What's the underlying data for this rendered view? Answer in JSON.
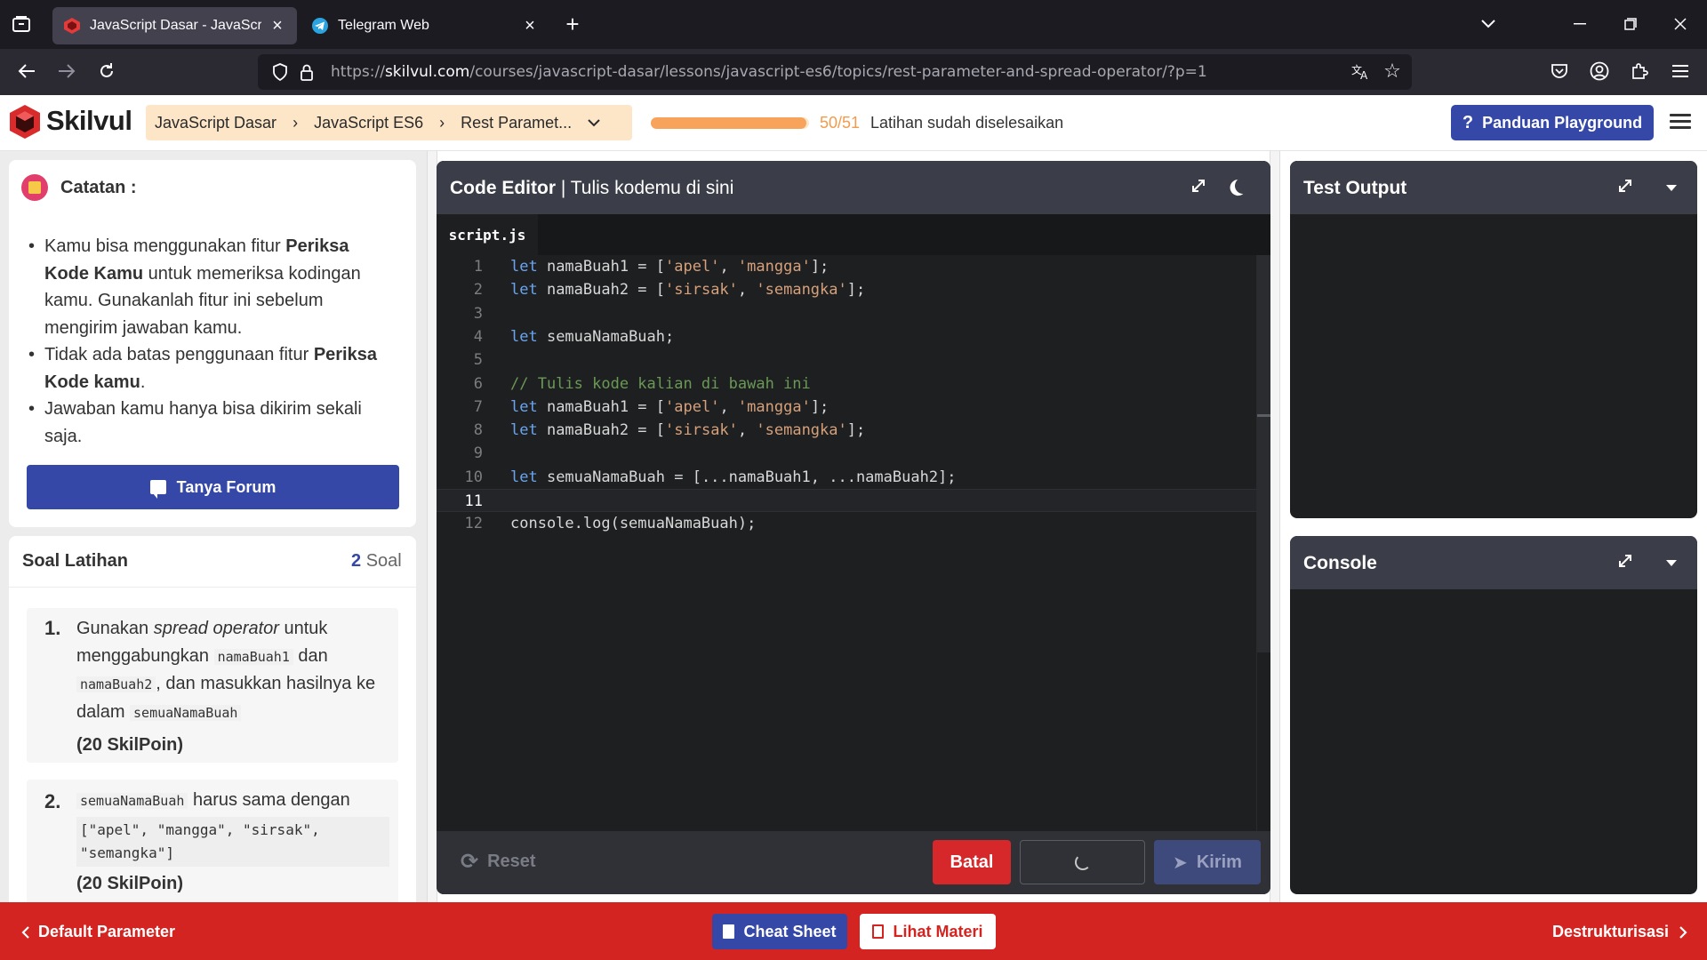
{
  "browser": {
    "tabs": [
      {
        "title": "JavaScript Dasar - JavaScript ES6",
        "active": true
      },
      {
        "title": "Telegram Web",
        "active": false
      }
    ],
    "url_prefix": "https://",
    "url_host": "skilvul.com",
    "url_path": "/courses/javascript-dasar/lessons/javascript-es6/topics/rest-parameter-and-spread-operator/?p=1"
  },
  "header": {
    "logo": "Skilvul",
    "breadcrumb": [
      "JavaScript Dasar",
      "JavaScript ES6",
      "Rest Paramet..."
    ],
    "progress": {
      "done": 50,
      "total": 51,
      "count_label": "50/51",
      "label": "Latihan sudah diselesaikan"
    },
    "guide_button": "Panduan Playground"
  },
  "notes": {
    "title": "Catatan :",
    "items": [
      {
        "pre": "Kamu bisa menggunakan fitur ",
        "bold": "Periksa Kode Kamu",
        "post": " untuk memeriksa kodingan kamu. Gunakanlah fitur ini sebelum mengirim jawaban kamu."
      },
      {
        "pre": "Tidak ada batas penggunaan fitur ",
        "bold": "Periksa Kode kamu",
        "post": "."
      },
      {
        "pre": "Jawaban kamu hanya bisa dikirim sekali saja.",
        "bold": "",
        "post": ""
      }
    ],
    "forum_button": "Tanya Forum"
  },
  "exercises": {
    "title": "Soal Latihan",
    "count": "2",
    "count_unit": "Soal",
    "questions": [
      {
        "num": "1.",
        "t1": "Gunakan ",
        "em": "spread operator",
        "t2": " untuk menggabungkan ",
        "c1": "namaBuah1",
        "t3": " dan ",
        "c2": "namaBuah2",
        "t4": ", dan masukkan hasilnya ke dalam ",
        "c3": "semuaNamaBuah",
        "points": "(20 SkilPoin)"
      },
      {
        "num": "2.",
        "c1": "semuaNamaBuah",
        "t1": " harus sama dengan",
        "block": "[\"apel\", \"mangga\", \"sirsak\",\n\"semangka\"]",
        "points": "(20 SkilPoin)"
      }
    ]
  },
  "editor": {
    "title_bold": "Code Editor",
    "title_rest": " | Tulis kodemu di sini",
    "file_tab": "script.js",
    "active_line": 11,
    "lines": [
      {
        "n": "1",
        "parts": [
          [
            "kw",
            "let"
          ],
          [
            "",
            " namaBuah1 = ["
          ],
          [
            "str",
            "'apel'"
          ],
          [
            "",
            ", "
          ],
          [
            "str",
            "'mangga'"
          ],
          [
            "",
            "];"
          ]
        ]
      },
      {
        "n": "2",
        "parts": [
          [
            "kw",
            "let"
          ],
          [
            "",
            " namaBuah2 = ["
          ],
          [
            "str",
            "'sirsak'"
          ],
          [
            "",
            ", "
          ],
          [
            "str",
            "'semangka'"
          ],
          [
            "",
            "];"
          ]
        ]
      },
      {
        "n": "3",
        "parts": []
      },
      {
        "n": "4",
        "parts": [
          [
            "kw",
            "let"
          ],
          [
            "",
            " semuaNamaBuah;"
          ]
        ]
      },
      {
        "n": "5",
        "parts": []
      },
      {
        "n": "6",
        "parts": [
          [
            "cmt",
            "// Tulis kode kalian di bawah ini"
          ]
        ]
      },
      {
        "n": "7",
        "parts": [
          [
            "kw",
            "let"
          ],
          [
            "",
            " namaBuah1 = ["
          ],
          [
            "str",
            "'apel'"
          ],
          [
            "",
            ", "
          ],
          [
            "str",
            "'mangga'"
          ],
          [
            "",
            "];"
          ]
        ]
      },
      {
        "n": "8",
        "parts": [
          [
            "kw",
            "let"
          ],
          [
            "",
            " namaBuah2 = ["
          ],
          [
            "str",
            "'sirsak'"
          ],
          [
            "",
            ", "
          ],
          [
            "str",
            "'semangka'"
          ],
          [
            "",
            "];"
          ]
        ]
      },
      {
        "n": "9",
        "parts": []
      },
      {
        "n": "10",
        "parts": [
          [
            "kw",
            "let"
          ],
          [
            "",
            " semuaNamaBuah = [...namaBuah1, ...namaBuah2];"
          ]
        ]
      },
      {
        "n": "11",
        "parts": []
      },
      {
        "n": "12",
        "parts": [
          [
            "",
            "console.log(semuaNamaBuah);"
          ]
        ]
      }
    ],
    "reset_label": "Reset",
    "cancel_label": "Batal",
    "submit_label": "Kirim"
  },
  "output_panel": {
    "title": "Test Output"
  },
  "console_panel": {
    "title": "Console"
  },
  "footer": {
    "prev": "Default Parameter",
    "next": "Destrukturisasi",
    "cheat_sheet": "Cheat Sheet",
    "materi": "Lihat Materi"
  },
  "colors": {
    "brand_blue": "#3548a8",
    "brand_red": "#d32421",
    "progress": "#f7a35c",
    "editor_bg": "#1e1f21"
  }
}
